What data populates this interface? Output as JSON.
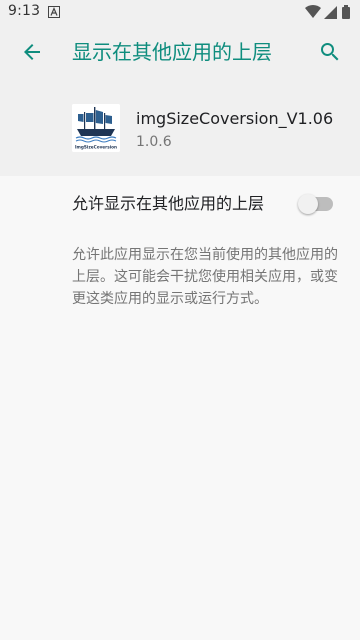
{
  "status_bar": {
    "time": "9:13",
    "notification_icon": "a-letter-icon",
    "icons": [
      "wifi-icon",
      "signal-icon",
      "battery-icon"
    ]
  },
  "app_bar": {
    "title": "显示在其他应用的上层",
    "back_icon": "arrow-left-icon",
    "search_icon": "search-icon",
    "accent_color": "#0f8d7e"
  },
  "app_info": {
    "name": "imgSizeCoversion_V1.06",
    "version": "1.0.6",
    "icon": "ship-logo-icon",
    "icon_caption": "ImgSizeCoversion"
  },
  "setting": {
    "label": "允许显示在其他应用的上层",
    "toggle_on": false
  },
  "description": "允许此应用显示在您当前使用的其他应用的上层。这可能会干扰您使用相关应用，或变更这类应用的显示或运行方式。"
}
